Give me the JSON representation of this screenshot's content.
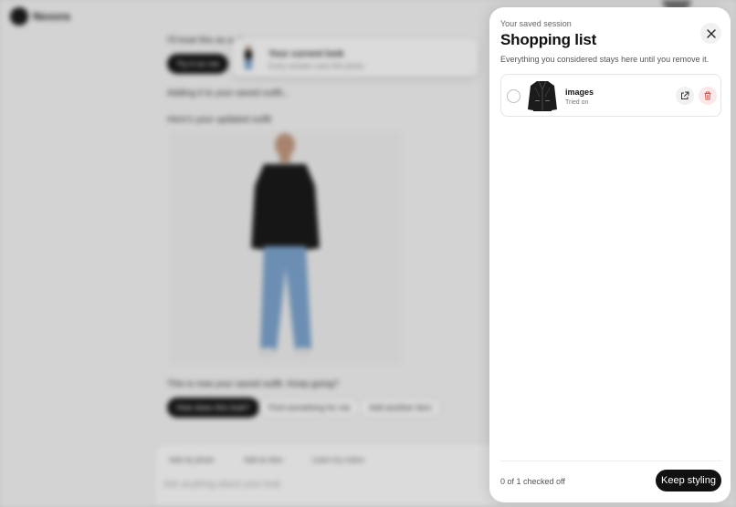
{
  "background": {
    "brand": "Nexora",
    "chat_line_1": "I'll treat this as a cl...",
    "try_on_button": "Try it on me",
    "toast_title": "Your current look",
    "toast_sub": "Every answer uses this photo",
    "status_adding": "Adding it to your saved outfit...",
    "status_updated": "Here's your updated outfit",
    "saved_outfit_text": "This is now your saved outfit. Keep going?",
    "suggestions": [
      "How does this look?",
      "Find something for me",
      "Add another item"
    ],
    "composer_tools": [
      "Add my photo",
      "Add an item",
      "Learn my colors"
    ],
    "composer_placeholder": "Ask anything about your look"
  },
  "panel": {
    "eyebrow": "Your saved session",
    "title": "Shopping list",
    "subtitle": "Everything you considered stays here until you remove it.",
    "items": [
      {
        "name": "images",
        "status": "Tried on",
        "checked": false,
        "thumb_icon": "leather-jacket"
      }
    ],
    "checked_count": "0 of 1 checked off",
    "keep_styling_label": "Keep styling"
  },
  "colors": {
    "primary_button": "#111111",
    "delete_accent": "#d9534f",
    "panel_bg": "#ffffff"
  }
}
